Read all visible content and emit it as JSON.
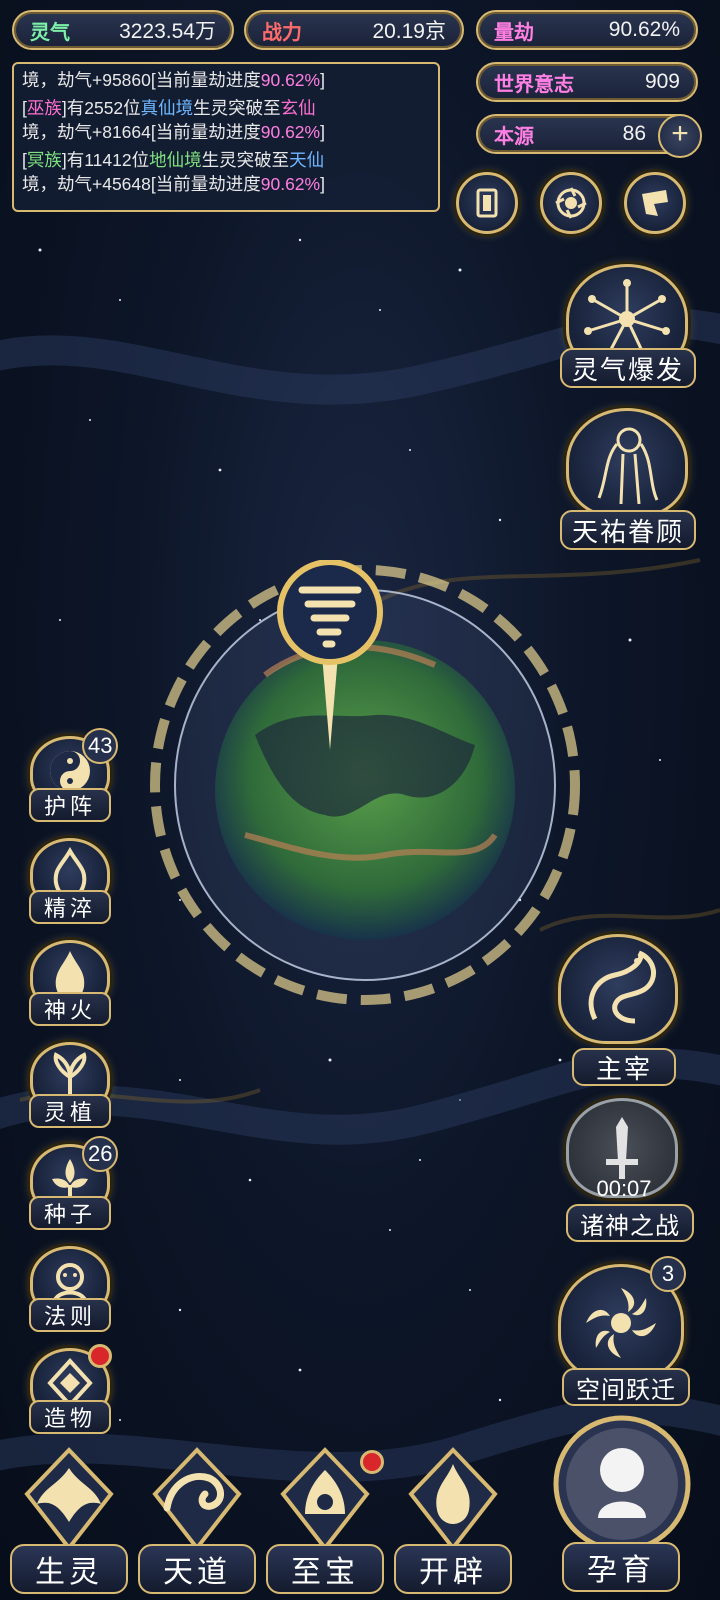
{
  "stats": {
    "lingqi": {
      "label": "灵气",
      "value": "3223.54万"
    },
    "zhanli": {
      "label": "战力",
      "value": "20.19京"
    },
    "liangjie": {
      "label": "量劫",
      "value": "90.62%"
    },
    "shijie": {
      "label": "世界意志",
      "value": "909"
    },
    "benyuan": {
      "label": "本源",
      "value": "86"
    }
  },
  "log": {
    "l1_a": "境，劫气+95860[当前量劫进度",
    "l1_pct": "90.62%",
    "l1_end": "]",
    "l2_open": "[",
    "l2_race": "巫族",
    "l2_mid": "]有2552位",
    "l2_realm1": "真仙境",
    "l2_mid2": "生灵突破至",
    "l2_realm2": "玄仙",
    "l2_line2": "境，劫气+81664[当前量劫进度",
    "l2_pct": "90.62%",
    "l2_end": "]",
    "l3_open": "[",
    "l3_race": "冥族",
    "l3_mid": "]有11412位",
    "l3_realm1": "地仙境",
    "l3_mid2": "生灵突破至",
    "l3_realm2": "天仙",
    "l3_line2": "境，劫气+45648[当前量劫进度",
    "l3_pct": "90.62%",
    "l3_end": "]"
  },
  "right": {
    "burst": "灵气爆发",
    "favor": "天祐眷顾",
    "master": "主宰",
    "war": "诸神之战",
    "war_timer": "00:07",
    "jump": "空间跃迁",
    "jump_badge": "3"
  },
  "left": [
    {
      "label": "护阵",
      "badge": "43"
    },
    {
      "label": "精淬",
      "badge": ""
    },
    {
      "label": "神火",
      "badge": ""
    },
    {
      "label": "灵植",
      "badge": ""
    },
    {
      "label": "种子",
      "badge": "26"
    },
    {
      "label": "法则",
      "badge": ""
    },
    {
      "label": "造物",
      "badge": ""
    }
  ],
  "nav": {
    "shengling": "生灵",
    "tiandao": "天道",
    "zhibao": "至宝",
    "kaipi": "开辟",
    "yunyu": "孕育"
  },
  "colors": {
    "gold": "#d7b972",
    "pink": "#ff7fe3",
    "blue": "#6fb6ff",
    "green": "#7fe07f",
    "red": "#d8262b"
  }
}
